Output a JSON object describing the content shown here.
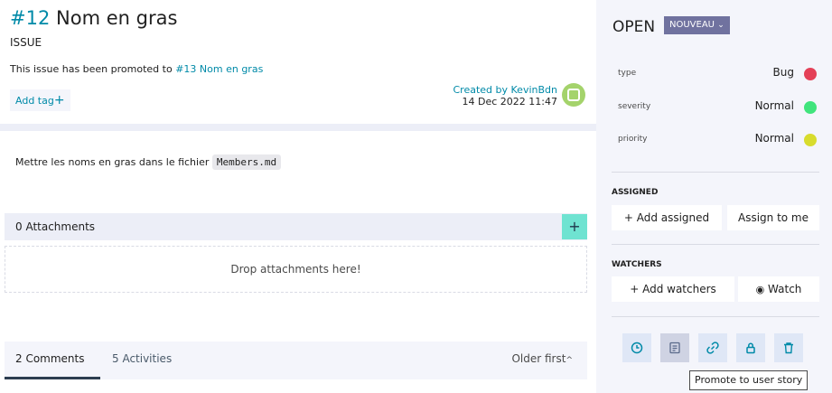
{
  "issue": {
    "ref": "#12",
    "subject": "Nom en gras",
    "type_label": "ISSUE",
    "promoted_text": "This issue has been promoted to",
    "promoted_link": "#13 Nom en gras",
    "add_tag_label": "Add tag",
    "created_by": "Created by KevinBdn",
    "created_date": "14 Dec 2022 11:47",
    "description_text": "Mettre les noms en gras dans le fichier",
    "description_code": "Members.md"
  },
  "attachments": {
    "title": "0 Attachments",
    "add_label": "+",
    "drop_text": "Drop attachments here!"
  },
  "comments": {
    "tab_comments": "2 Comments",
    "tab_activities": "5 Activities",
    "order_label": "Older first"
  },
  "sidebar": {
    "status": "OPEN",
    "status_badge": "NOUVEAU",
    "attributes": [
      {
        "label": "type",
        "value": "Bug",
        "color": "#e44057"
      },
      {
        "label": "severity",
        "value": "Normal",
        "color": "#40e47c"
      },
      {
        "label": "priority",
        "value": "Normal",
        "color": "#d8dc2d"
      }
    ],
    "assigned_heading": "ASSIGNED",
    "add_assigned": "+ Add assigned",
    "assign_to_me": "Assign to me",
    "watchers_heading": "WATCHERS",
    "add_watchers": "+ Add watchers",
    "watch": "Watch",
    "actions": [
      "clock-icon",
      "promote-icon",
      "link-icon",
      "lock-icon",
      "trash-icon"
    ],
    "tooltip": "Promote to user story"
  },
  "colors": {
    "accent": "#008aa8",
    "status_badge": "#70729f",
    "add_button": "#6fe3d1"
  }
}
